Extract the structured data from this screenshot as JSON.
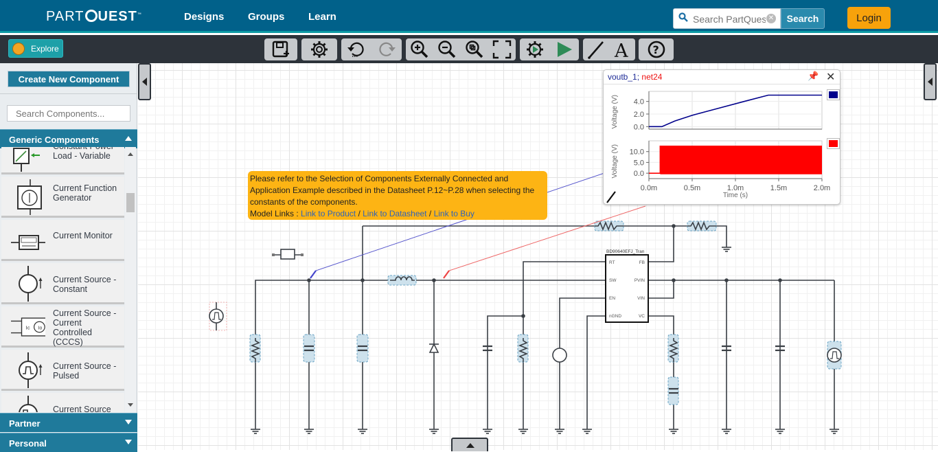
{
  "header": {
    "logo_left": "PART",
    "logo_right": "UEST",
    "nav": [
      "Designs",
      "Groups",
      "Learn"
    ],
    "search_placeholder": "Search PartQuest",
    "search_label": "Search",
    "login_label": "Login"
  },
  "toolbar": {
    "explore_label": "Explore",
    "tools": [
      "save-icon",
      "settings-icon",
      "undo-icon",
      "redo-icon",
      "zoom-in-icon",
      "zoom-out-icon",
      "zoom-fit-icon",
      "fullscreen-icon",
      "simulation-settings-icon",
      "run-icon",
      "wire-icon",
      "text-icon",
      "help-icon"
    ]
  },
  "sidebar": {
    "create_label": "Create New Component",
    "search_placeholder": "Search Components...",
    "sections": [
      {
        "label": "Generic Components",
        "expanded": true
      },
      {
        "label": "Partner",
        "expanded": false
      },
      {
        "label": "Personal",
        "expanded": false
      }
    ],
    "components": [
      {
        "label": "Constant Power Load - Variable"
      },
      {
        "label": "Current Function Generator"
      },
      {
        "label": "Current Monitor"
      },
      {
        "label": "Current Source - Constant"
      },
      {
        "label": "Current Source - Current Controlled (CCCS)"
      },
      {
        "label": "Current Source - Pulsed"
      },
      {
        "label": "Current Source"
      }
    ]
  },
  "note": {
    "text": "Please refer to the Selection of Components Externally Connected and Application Example described in the Datasheet P.12~P.28 when selecting the constants of the components.",
    "links_label": "Model Links :",
    "links": [
      "Link to Product",
      "Link to Datasheet",
      "Link to Buy"
    ],
    "sep": "/"
  },
  "schematic": {
    "ic_name": "BD90640EFJ_Tran",
    "pins_left": [
      "RT",
      "SW",
      "EN",
      "nGND"
    ],
    "pins_right": [
      "FB",
      "PVIN",
      "VIN",
      "VC"
    ]
  },
  "scope": {
    "title_a": "voutb_1;",
    "title_b": "net24",
    "colors": {
      "a": "#00008b",
      "b": "#ff0000"
    },
    "pin_icon": "pin-icon",
    "close_icon": "close-icon"
  },
  "chart_data": [
    {
      "type": "line",
      "series": [
        {
          "name": "voutb_1",
          "color": "#00008b",
          "x": [
            0.0,
            0.15,
            0.3,
            0.5,
            0.8,
            1.1,
            1.38,
            1.6,
            2.0
          ],
          "y": [
            0.0,
            0.0,
            0.9,
            1.8,
            2.9,
            4.0,
            5.0,
            5.0,
            5.0
          ]
        }
      ],
      "ylabel": "Voltage (V)",
      "yticks": [
        "0.0",
        "2.0",
        "4.0"
      ],
      "ylim": [
        -0.4,
        5.6
      ],
      "xlim": [
        0.0,
        2.0
      ],
      "grid": true
    },
    {
      "type": "line",
      "series": [
        {
          "name": "net24",
          "color": "#ff0000",
          "x": [
            0.0,
            0.13,
            0.13,
            2.0
          ],
          "y": [
            0.0,
            0.0,
            12.5,
            12.5
          ],
          "switching_band": {
            "from": 0.13,
            "to": 2.0,
            "low": -0.5,
            "high": 12.5
          }
        }
      ],
      "ylabel": "Voltage (V)",
      "xlabel": "Time (s)",
      "yticks": [
        "0.0",
        "5.0",
        "10.0"
      ],
      "xticks": [
        "0.0m",
        "0.5m",
        "1.0m",
        "1.5m",
        "2.0m"
      ],
      "ylim": [
        -2.5,
        15.0
      ],
      "xlim": [
        0.0,
        2.0
      ],
      "grid": true
    }
  ]
}
